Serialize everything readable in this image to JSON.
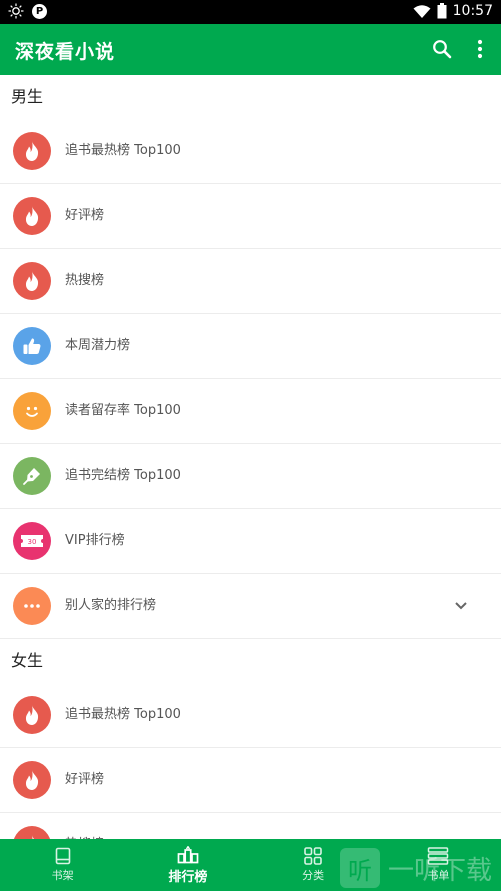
{
  "status_bar": {
    "time": "10:57",
    "badge": "P",
    "icons": [
      "brightness-icon",
      "wifi-icon",
      "battery-icon"
    ]
  },
  "app_bar": {
    "title": "深夜看小说",
    "color": "#00a94f",
    "actions": [
      "search-icon",
      "more-vert-icon"
    ]
  },
  "sections": [
    {
      "title": "男生",
      "items": [
        {
          "label": "追书最热榜 Top100",
          "icon": "flame-icon",
          "color": "#e65a4e"
        },
        {
          "label": "好评榜",
          "icon": "flame-icon",
          "color": "#e65a4e"
        },
        {
          "label": "热搜榜",
          "icon": "flame-icon",
          "color": "#e65a4e"
        },
        {
          "label": "本周潜力榜",
          "icon": "thumbs-up-icon",
          "color": "#5aa3e8"
        },
        {
          "label": "读者留存率 Top100",
          "icon": "smiley-icon",
          "color": "#f9a23a"
        },
        {
          "label": "追书完结榜 Top100",
          "icon": "pen-icon",
          "color": "#7bb661"
        },
        {
          "label": "VIP排行榜",
          "icon": "ticket-icon",
          "color": "#e8336f",
          "ticket_text": "30"
        },
        {
          "label": "别人家的排行榜",
          "icon": "dots-icon",
          "color": "#fb8a55",
          "expandable": true
        }
      ]
    },
    {
      "title": "女生",
      "items": [
        {
          "label": "追书最热榜 Top100",
          "icon": "flame-icon",
          "color": "#e65a4e"
        },
        {
          "label": "好评榜",
          "icon": "flame-icon",
          "color": "#e65a4e"
        },
        {
          "label": "热搜榜",
          "icon": "flame-icon",
          "color": "#e65a4e"
        }
      ]
    }
  ],
  "bottom_nav": {
    "active": 1,
    "tabs": [
      {
        "label": "书架",
        "icon": "bookshelf-icon"
      },
      {
        "label": "排行榜",
        "icon": "ranking-icon"
      },
      {
        "label": "分类",
        "icon": "category-grid-icon"
      },
      {
        "label": "书单",
        "icon": "booklist-icon"
      }
    ]
  },
  "watermark": {
    "glyph": "听",
    "text": "一听下载"
  }
}
